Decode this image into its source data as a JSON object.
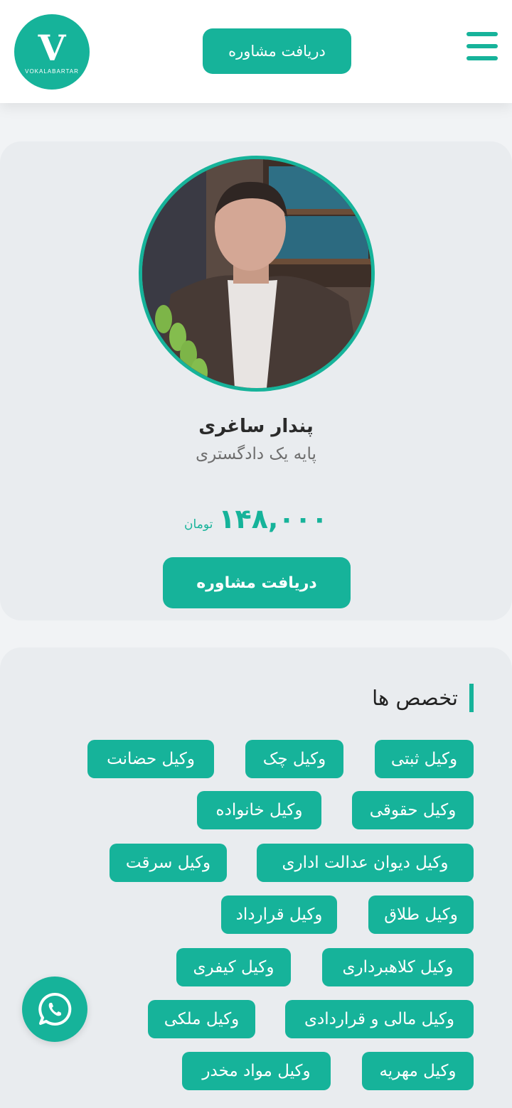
{
  "header": {
    "logo_letter": "V",
    "logo_text": "VOKALABARTAR",
    "consult_button": "دریافت مشاوره"
  },
  "profile": {
    "name": "پندار ساغری",
    "title": "پایه یک دادگستری",
    "price": "۱۴۸,۰۰۰",
    "currency": "تومان",
    "consult_button": "دریافت مشاوره"
  },
  "specialties": {
    "heading": "تخصص ها",
    "items": [
      "وکیل ثبتی",
      "وکیل چک",
      "وکیل حضانت",
      "وکیل حقوقی",
      "وکیل خانواده",
      "وکیل دیوان عدالت اداری",
      "وکیل سرقت",
      "وکیل طلاق",
      "وکیل قرارداد",
      "وکیل کلاهبرداری",
      "وکیل کیفری",
      "وکیل مالی و قراردادی",
      "وکیل ملکی",
      "وکیل مهریه",
      "وکیل مواد مخدر"
    ]
  },
  "colors": {
    "accent": "#16b39a",
    "card_bg": "#e9ecef",
    "page_bg": "#f1f3f5"
  },
  "icons": {
    "menu": "hamburger-menu-icon",
    "whatsapp": "whatsapp-icon"
  }
}
